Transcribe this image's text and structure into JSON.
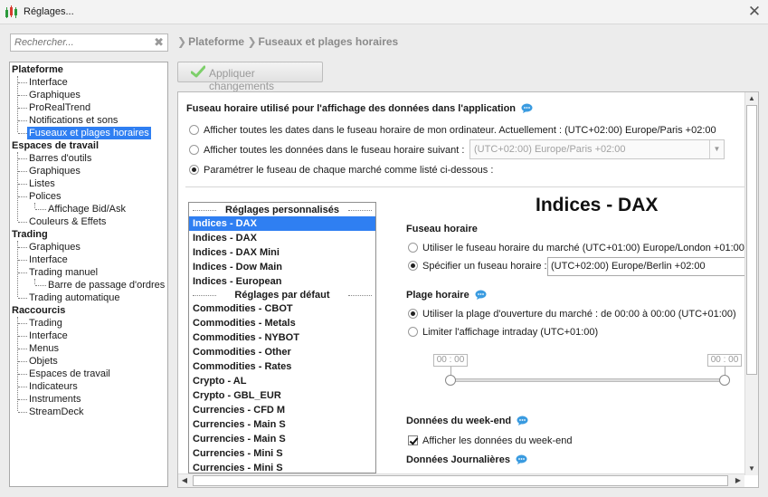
{
  "window": {
    "title": "Réglages...",
    "close_glyph": "✕"
  },
  "search": {
    "placeholder": "Rechercher..."
  },
  "tree": {
    "categories": [
      {
        "label": "Plateforme",
        "items": [
          "Interface",
          "Graphiques",
          "ProRealTrend",
          "Notifications et sons",
          "Fuseaux et plages horaires"
        ]
      },
      {
        "label": "Espaces de travail",
        "items": [
          "Barres d'outils",
          "Graphiques",
          "Listes",
          "Polices",
          "Affichage Bid/Ask",
          "Couleurs & Effets"
        ]
      },
      {
        "label": "Trading",
        "items": [
          "Graphiques",
          "Interface",
          "Trading manuel",
          "Barre de passage d'ordres",
          "Trading automatique"
        ]
      },
      {
        "label": "Raccourcis",
        "items": [
          "Trading",
          "Interface",
          "Menus",
          "Objets",
          "Espaces de travail",
          "Indicateurs",
          "Instruments",
          "StreamDeck"
        ]
      }
    ],
    "selected": "Fuseaux et plages horaires"
  },
  "breadcrumb": [
    "Plateforme",
    "Fuseaux et plages horaires"
  ],
  "apply_button": {
    "label": "Appliquer changements",
    "enabled": false
  },
  "timezone_section": {
    "title": "Fuseau horaire utilisé pour l'affichage des données dans l'application",
    "options": [
      {
        "label": "Afficher toutes les dates dans le fuseau horaire de mon ordinateur. Actuellement : (UTC+02:00) Europe/Paris +02:00",
        "selected": false
      },
      {
        "label": "Afficher toutes les données dans le fuseau horaire suivant :",
        "selected": false
      },
      {
        "label": "Paramétrer le fuseau de chaque marché comme listé ci-dessous :",
        "selected": true
      }
    ],
    "select_value": "(UTC+02:00) Europe/Paris +02:00"
  },
  "market_list": {
    "custom_header": "Réglages personnalisés",
    "custom_items": [
      "Indices - DAX",
      "Indices - DAX",
      "Indices - DAX Mini",
      "Indices - Dow Main",
      "Indices - European"
    ],
    "default_header": "Réglages par défaut",
    "default_items": [
      "Commodities - CBOT",
      "Commodities - Metals",
      "Commodities - NYBOT",
      "Commodities - Other",
      "Commodities - Rates",
      "Crypto - AL",
      "Crypto - GBL_EUR",
      "Currencies - CFD M",
      "Currencies - Main S",
      "Currencies - Main S",
      "Currencies - Mini S",
      "Currencies - Mini S"
    ],
    "selected_index": 0
  },
  "market_detail": {
    "title": "Indices - DAX",
    "fuseau": {
      "title": "Fuseau horaire",
      "options": [
        {
          "label": "Utiliser le fuseau horaire du marché (UTC+01:00) Europe/London +01:00",
          "selected": false
        },
        {
          "label": "Spécifier un fuseau horaire :",
          "selected": true
        }
      ],
      "input_value": "(UTC+02:00) Europe/Berlin +02:00"
    },
    "plage": {
      "title": "Plage horaire",
      "options": [
        {
          "label": "Utiliser la plage d'ouverture du marché : de 00:00 à 00:00  (UTC+01:00)",
          "selected": true
        },
        {
          "label": "Limiter l'affichage intraday  (UTC+01:00)",
          "selected": false
        }
      ],
      "slider_start": "00 : 00",
      "slider_end": "00 : 00"
    },
    "weekend": {
      "title": "Données du week-end",
      "checkbox_label": "Afficher les données du week-end",
      "checked": true
    },
    "daily": {
      "title": "Données Journalières"
    }
  },
  "colors": {
    "accent": "#2f7ff2",
    "info_icon": "#3a9be0",
    "check": "#5fc24a"
  }
}
